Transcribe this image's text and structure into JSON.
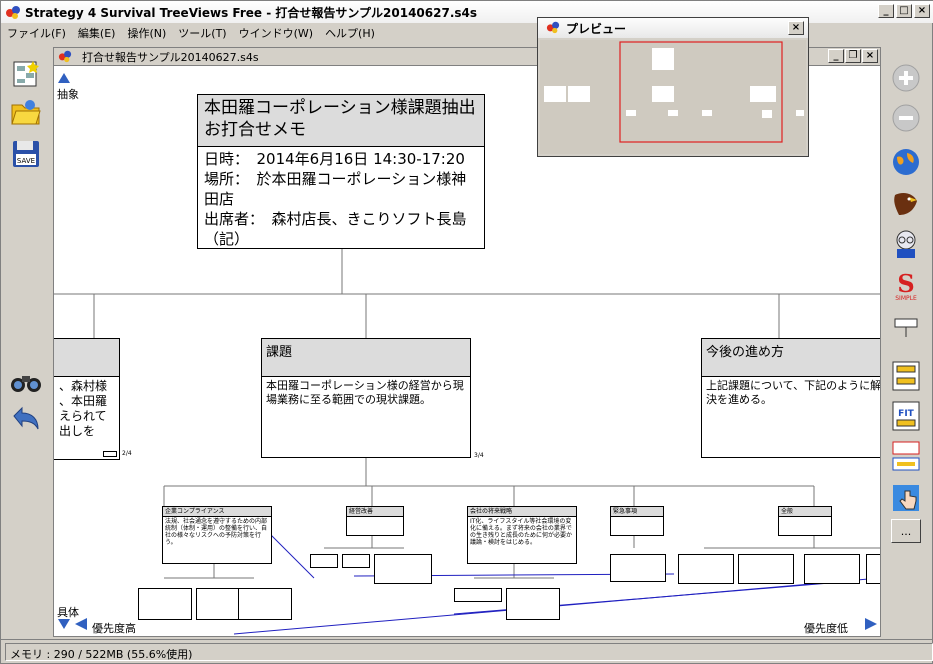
{
  "window": {
    "title": "Strategy 4 Survival TreeViews Free - 打合せ報告サンプル20140627.s4s"
  },
  "menu": [
    "ファイル(F)",
    "編集(E)",
    "操作(N)",
    "ツール(T)",
    "ウインドウ(W)",
    "ヘルプ(H)"
  ],
  "document": {
    "title": "打合せ報告サンプル20140627.s4s",
    "abstract_label": "抽象",
    "concrete_label": "具体",
    "priority_high": "優先度高",
    "priority_low": "優先度低"
  },
  "root": {
    "title": "本田羅コーポレーション様課題抽出お打合せメモ",
    "body_lines": [
      "日時：　2014年6月16日 14:30-17:20",
      "場所：　於本田羅コーポレーション様神田店",
      "出席者：　森村店長、きこりソフト長島（記）"
    ]
  },
  "nodes": {
    "left_partial": {
      "lines": [
        "、森村様",
        "、本田羅",
        "えられて",
        "出しを"
      ],
      "page": "2/4"
    },
    "kadai": {
      "title": "課題",
      "body": "本田羅コーポレーション様の経営から現場業務に至る範囲での現状課題。",
      "page": "3/4"
    },
    "kongo": {
      "title": "今後の進め方",
      "body": "上記課題について、下記のように解決を進める。"
    }
  },
  "subnodes": [
    {
      "title": "企業コンプライアンス",
      "body": "法規、社会通念を遵守するための内部統制（体制・運用）の整備を行い、自社の様々なリスクへの予防対策を行う。"
    },
    {
      "title": "経営改善",
      "body": ""
    },
    {
      "title": "会社の将来戦略",
      "body": "IT化、ライフスタイル等社会環境の変化に備える。まず将来の会社の業界での生き残りと成長のために何が必要か議論・検討をはじめる。"
    },
    {
      "title": "緊急事項",
      "body": ""
    },
    {
      "title": "全般",
      "body": ""
    }
  ],
  "preview": {
    "title": "プレビュー"
  },
  "status": {
    "memory": "メモリ : 290 / 522MB (55.6%使用)"
  },
  "toolbar": {
    "save_label": "SAVE",
    "simple_label": "SIMPLE",
    "fit_label": "FIT",
    "more_label": "..."
  },
  "colors": {
    "accent_red": "#d62020",
    "link_blue": "#2020c0"
  }
}
